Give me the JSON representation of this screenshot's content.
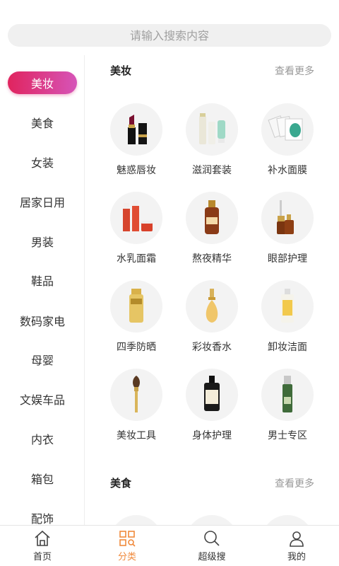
{
  "search": {
    "placeholder": "请输入搜索内容"
  },
  "sidebar": {
    "items": [
      {
        "label": "美妆"
      },
      {
        "label": "美食"
      },
      {
        "label": "女装"
      },
      {
        "label": "居家日用"
      },
      {
        "label": "男装"
      },
      {
        "label": "鞋品"
      },
      {
        "label": "数码家电"
      },
      {
        "label": "母婴"
      },
      {
        "label": "文娱车品"
      },
      {
        "label": "内衣"
      },
      {
        "label": "箱包"
      },
      {
        "label": "配饰"
      }
    ],
    "active_index": 0
  },
  "sections": [
    {
      "title": "美妆",
      "more": "查看更多",
      "items": [
        {
          "label": "魅惑唇妆",
          "icon": "lipstick-icon"
        },
        {
          "label": "滋润套装",
          "icon": "skincare-set-icon"
        },
        {
          "label": "补水面膜",
          "icon": "face-mask-icon"
        },
        {
          "label": "水乳面霜",
          "icon": "lotion-cream-icon"
        },
        {
          "label": "熬夜精华",
          "icon": "serum-bottle-icon"
        },
        {
          "label": "眼部护理",
          "icon": "eye-serum-icon"
        },
        {
          "label": "四季防晒",
          "icon": "sunscreen-icon"
        },
        {
          "label": "彩妆香水",
          "icon": "perfume-icon"
        },
        {
          "label": "卸妆洁面",
          "icon": "cleanser-icon"
        },
        {
          "label": "美妆工具",
          "icon": "makeup-brush-icon"
        },
        {
          "label": "身体护理",
          "icon": "body-oil-icon"
        },
        {
          "label": "男士专区",
          "icon": "mens-bottle-icon"
        }
      ]
    },
    {
      "title": "美食",
      "more": "查看更多",
      "items": []
    }
  ],
  "tabbar": {
    "items": [
      {
        "label": "首页",
        "icon": "home-icon"
      },
      {
        "label": "分类",
        "icon": "category-icon"
      },
      {
        "label": "超级搜",
        "icon": "search-icon"
      },
      {
        "label": "我的",
        "icon": "user-icon"
      }
    ],
    "active_index": 1
  },
  "colors": {
    "accent_gradient_start": "#e0245e",
    "accent_gradient_end": "#d654b8",
    "tab_active": "#f08a3c"
  }
}
